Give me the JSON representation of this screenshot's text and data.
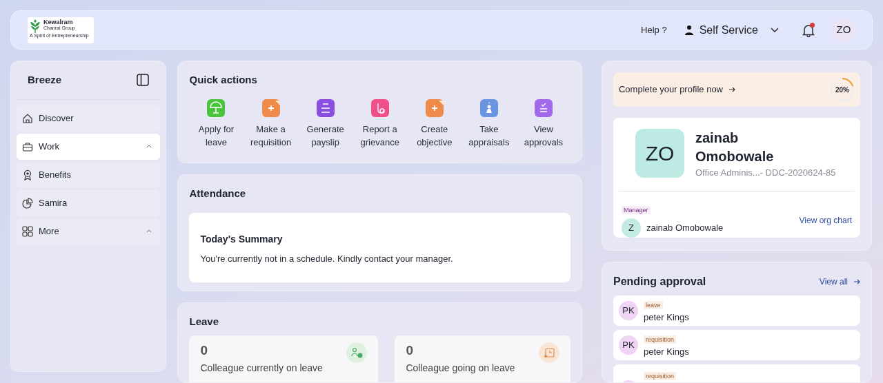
{
  "header": {
    "logo": {
      "name": "Kewalram",
      "sub": "Chanrai Group",
      "tagline": "A Spirit of Entrepreneurship"
    },
    "help": "Help ?",
    "role_menu": "Self Service",
    "notifications": {
      "unread": true
    },
    "avatar": "ZO"
  },
  "sidebar": {
    "title": "Breeze",
    "items": [
      {
        "kind": "home",
        "label": "Discover",
        "selected": false
      },
      {
        "kind": "briefcase",
        "label": "Work",
        "selected": true,
        "expanded": true
      },
      {
        "kind": "award",
        "label": "Benefits",
        "selected": false
      },
      {
        "kind": "chart",
        "label": "Samira",
        "selected": false
      },
      {
        "kind": "grid",
        "label": "More",
        "selected": false,
        "expanded": true
      }
    ]
  },
  "quick_actions": {
    "title": "Quick actions",
    "items": [
      {
        "kind": "umbrella",
        "label": "Apply for leave",
        "color": "#4cc23e"
      },
      {
        "kind": "plus",
        "label": "Make a requisition",
        "color": "#ee8a4a"
      },
      {
        "kind": "lines",
        "label": "Generate payslip",
        "color": "#8a4ee0"
      },
      {
        "kind": "hand",
        "label": "Report a grievance",
        "color": "#f0508a"
      },
      {
        "kind": "plus",
        "label": "Create objective",
        "color": "#ee8a4a"
      },
      {
        "kind": "person",
        "label": "Take appraisals",
        "color": "#6a94e0"
      },
      {
        "kind": "check",
        "label": "View approvals",
        "color": "#a168ec"
      }
    ]
  },
  "attendance": {
    "title": "Attendance",
    "summary_title": "Today's Summary",
    "message": "You're currently not in a schedule. Kindly contact your manager."
  },
  "leave": {
    "title": "Leave",
    "stats": [
      {
        "kind": "current",
        "value": "0",
        "label": "Colleague currently on leave",
        "color": "#dff2df"
      },
      {
        "kind": "upcoming",
        "value": "0",
        "label": "Colleague going on leave",
        "color": "#fbe6d6"
      }
    ]
  },
  "profile": {
    "completion": {
      "text": "Complete your profile now",
      "reading": "20%",
      "level": 0.2
    },
    "initials": "ZO",
    "first_name": "zainab",
    "last_name": "Omobowale",
    "subtitle": "Office Adminis...- DDC-2020624-85",
    "manager_label": "Manager",
    "manager_initial": "Z",
    "manager_name": "zainab Omobowale",
    "org_link": "View org chart"
  },
  "pending": {
    "title": "Pending approval",
    "view_all": "View all",
    "items": [
      {
        "initials": "PK",
        "tag": "leave",
        "name": "peter Kings"
      },
      {
        "initials": "PK",
        "tag": "requisition",
        "name": "peter Kings"
      },
      {
        "tag": "requisition"
      }
    ]
  }
}
